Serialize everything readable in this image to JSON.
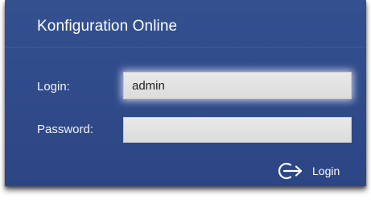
{
  "title": "Konfiguration Online",
  "form": {
    "login_label": "Login:",
    "login_value": "admin",
    "password_label": "Password:",
    "password_value": ""
  },
  "actions": {
    "login_label": "Login",
    "login_icon": "login-arrow-icon"
  },
  "colors": {
    "panel": "#2f4a8a",
    "field": "#e1e1e1",
    "text": "#ffffff"
  }
}
